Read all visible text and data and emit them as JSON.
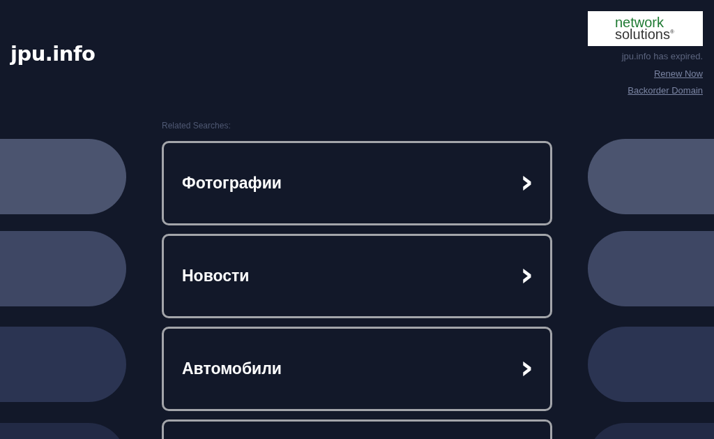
{
  "site_title": "jpu.info",
  "registrar": {
    "logo_line_1": "network",
    "logo_line_2": "solutions",
    "logo_mark": "®",
    "notice": "jpu.info has expired.",
    "links": [
      "Renew Now",
      "Backorder Domain"
    ]
  },
  "related_searches": {
    "label": "Related Searches:",
    "items": [
      {
        "label": "Фотографии",
        "chevron": "›"
      },
      {
        "label": "Новости",
        "chevron": "›"
      },
      {
        "label": "Автомобили",
        "chevron": "›"
      }
    ]
  }
}
